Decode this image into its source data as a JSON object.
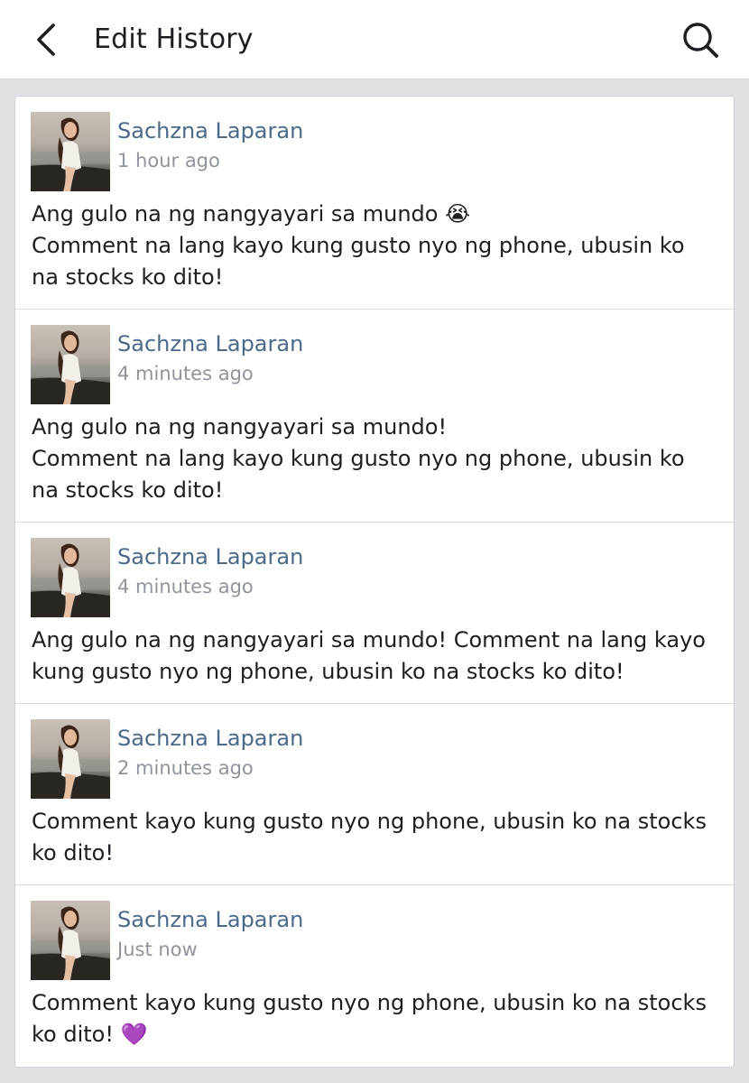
{
  "header": {
    "title": "Edit History",
    "back_icon": "chevron-left-icon",
    "search_icon": "search-icon"
  },
  "entries": [
    {
      "author": "Sachzna Laparan",
      "time": "1 hour ago",
      "text": "Ang gulo na ng nangyayari sa mundo 😭\nComment na lang kayo kung gusto nyo ng phone, ubusin ko na stocks ko dito!"
    },
    {
      "author": "Sachzna Laparan",
      "time": "4 minutes ago",
      "text": "Ang gulo na ng nangyayari sa mundo!\nComment na lang kayo kung gusto nyo ng phone, ubusin ko na stocks ko dito!"
    },
    {
      "author": "Sachzna Laparan",
      "time": "4 minutes ago",
      "text": "Ang gulo na ng nangyayari sa mundo! Comment na lang kayo kung gusto nyo ng phone, ubusin ko na stocks ko dito!"
    },
    {
      "author": "Sachzna Laparan",
      "time": "2 minutes ago",
      "text": "Comment kayo kung gusto nyo ng phone, ubusin ko na stocks ko dito!"
    },
    {
      "author": "Sachzna Laparan",
      "time": "Just now",
      "text": "Comment kayo kung gusto nyo ng phone, ubusin ko na stocks ko dito! 💜"
    }
  ],
  "colors": {
    "name": "#4b6a8a",
    "time": "#90949c",
    "text": "#1c1e21",
    "background": "#dfe1e5"
  }
}
